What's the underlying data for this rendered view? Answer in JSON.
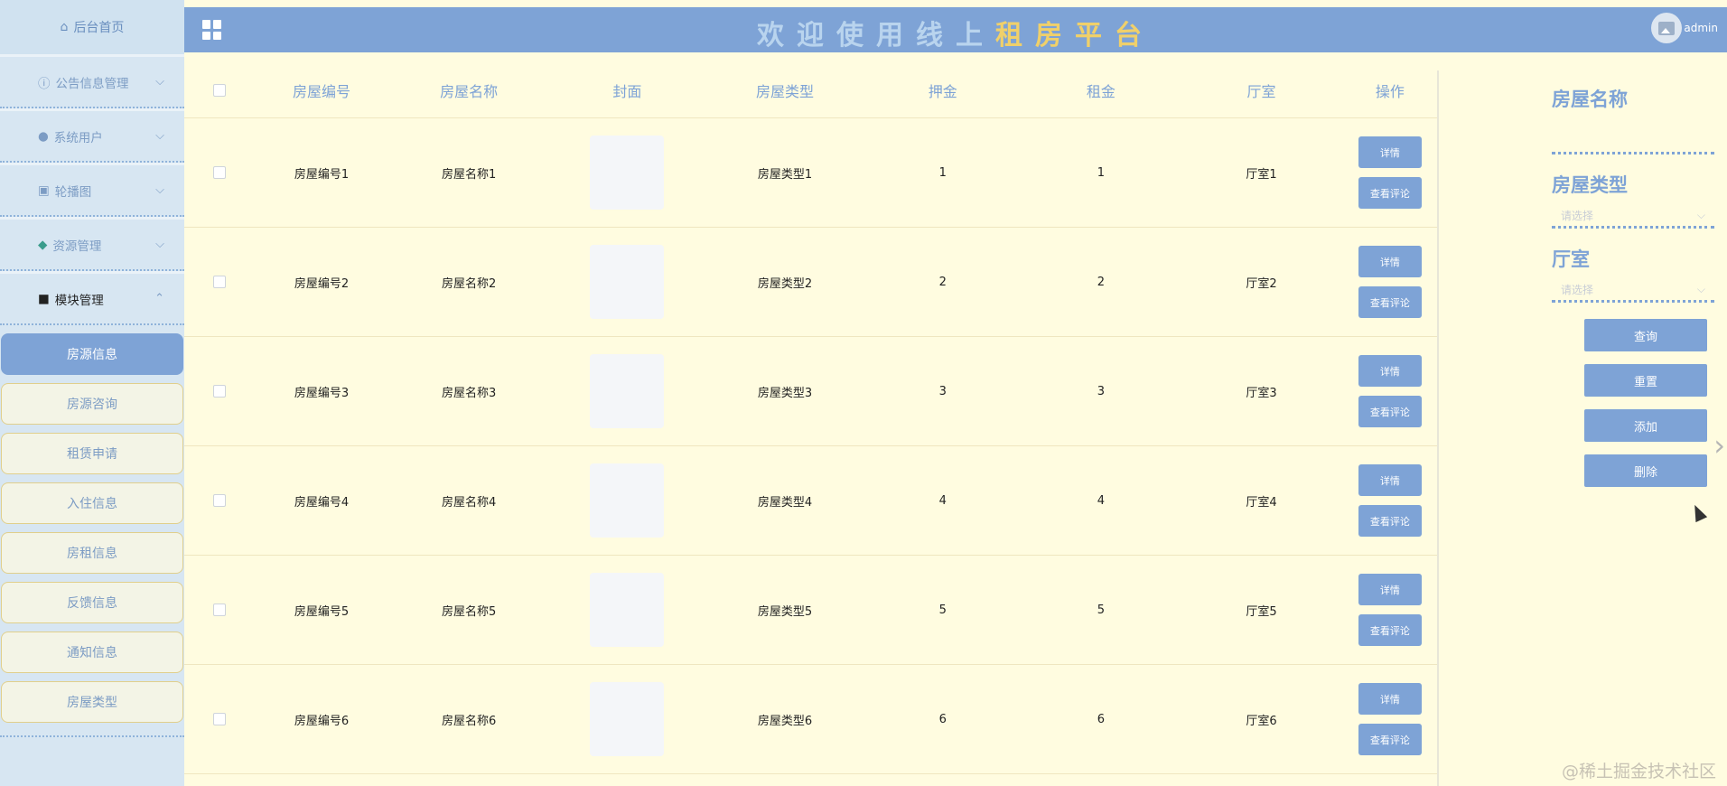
{
  "sidebar": {
    "home": "后台首页",
    "menus": [
      {
        "label": "公告信息管理",
        "icon": "info-icon"
      },
      {
        "label": "系统用户",
        "icon": "user-icon"
      },
      {
        "label": "轮播图",
        "icon": "image-icon"
      },
      {
        "label": "资源管理",
        "icon": "location-icon"
      },
      {
        "label": "模块管理",
        "icon": "grid-icon"
      }
    ],
    "sub_items": [
      "房源信息",
      "房源咨询",
      "租赁申请",
      "入住信息",
      "房租信息",
      "反馈信息",
      "通知信息",
      "房屋类型"
    ]
  },
  "header": {
    "title_part1": "欢迎使用线上",
    "title_part2": "租房平台",
    "username": "admin"
  },
  "table": {
    "headers": [
      "房屋编号",
      "房屋名称",
      "封面",
      "房屋类型",
      "押金",
      "租金",
      "厅室",
      "操作"
    ],
    "rows": [
      {
        "num": "房屋编号1",
        "name": "房屋名称1",
        "type": "房屋类型1",
        "deposit": "1",
        "rent": "1",
        "hall": "厅室1"
      },
      {
        "num": "房屋编号2",
        "name": "房屋名称2",
        "type": "房屋类型2",
        "deposit": "2",
        "rent": "2",
        "hall": "厅室2"
      },
      {
        "num": "房屋编号3",
        "name": "房屋名称3",
        "type": "房屋类型3",
        "deposit": "3",
        "rent": "3",
        "hall": "厅室3"
      },
      {
        "num": "房屋编号4",
        "name": "房屋名称4",
        "type": "房屋类型4",
        "deposit": "4",
        "rent": "4",
        "hall": "厅室4"
      },
      {
        "num": "房屋编号5",
        "name": "房屋名称5",
        "type": "房屋类型5",
        "deposit": "5",
        "rent": "5",
        "hall": "厅室5"
      },
      {
        "num": "房屋编号6",
        "name": "房屋名称6",
        "type": "房屋类型6",
        "deposit": "6",
        "rent": "6",
        "hall": "厅室6"
      }
    ],
    "detail_btn": "详情",
    "comment_btn": "查看评论"
  },
  "search": {
    "name_label": "房屋名称",
    "type_label": "房屋类型",
    "hall_label": "厅室",
    "select_placeholder": "请选择",
    "query_btn": "查询",
    "reset_btn": "重置",
    "add_btn": "添加",
    "delete_btn": "删除"
  },
  "watermark": "@稀土掘金技术社区"
}
